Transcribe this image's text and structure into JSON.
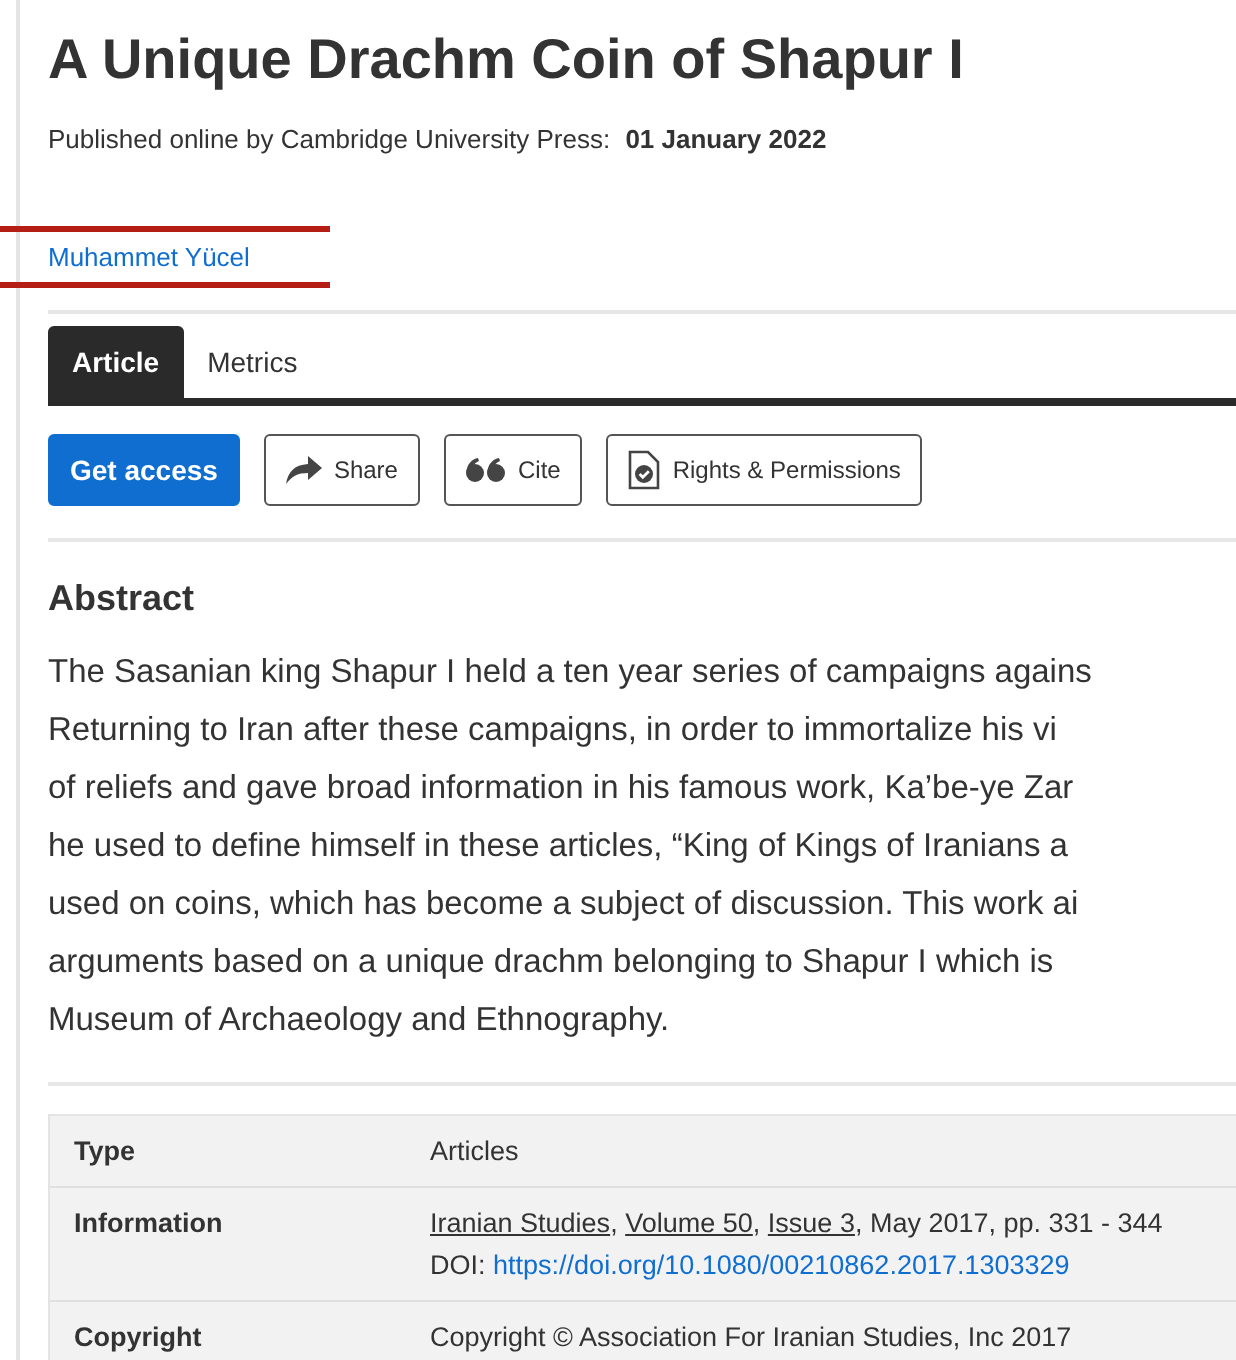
{
  "title": "A Unique Drachm Coin of Shapur I",
  "published": {
    "label": "Published online by Cambridge University Press:",
    "date": "01 January 2022"
  },
  "author": "Muhammet Yücel",
  "tabs": [
    {
      "label": "Article",
      "selected": true
    },
    {
      "label": "Metrics",
      "selected": false
    }
  ],
  "actions": [
    {
      "kind": "primary",
      "label": "Get access"
    },
    {
      "kind": "share",
      "label": "Share"
    },
    {
      "kind": "cite",
      "label": "Cite"
    },
    {
      "kind": "rights",
      "label": "Rights & Permissions"
    }
  ],
  "abstract": {
    "heading": "Abstract",
    "lines": [
      "The Sasanian king Shapur I held a ten year series of campaigns agains",
      "Returning to Iran after these campaigns, in order to immortalize his vi",
      "of reliefs and gave broad information in his famous work, Ka’be-ye Zar",
      "he used to define himself in these articles, “King of Kings of Iranians a",
      "used on coins, which has become a subject of discussion. This work ai",
      "arguments based on a unique drachm belonging to Shapur I which is",
      "Museum of Archaeology and Ethnography."
    ]
  },
  "details": [
    {
      "label": "Type",
      "value": "Articles"
    },
    {
      "label": "Information",
      "links": [
        {
          "text": "Iranian Studies",
          "after": ","
        },
        {
          "text": "Volume 50",
          "after": ","
        },
        {
          "text": "Issue 3",
          "after": ", May 2017, pp. 331 - 344"
        }
      ],
      "doi_label": "DOI:",
      "doi": "https://doi.org/10.1080/00210862.2017.1303329"
    },
    {
      "label": "Copyright",
      "value": "Copyright © Association For Iranian Studies, Inc 2017"
    }
  ]
}
